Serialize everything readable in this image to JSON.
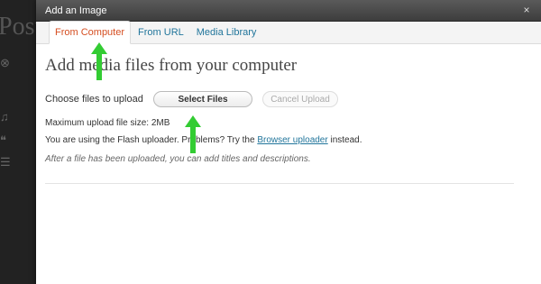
{
  "background": {
    "post_title_fragment": "Post"
  },
  "modal": {
    "title": "Add an Image",
    "close_glyph": "×"
  },
  "tabs": [
    {
      "label": "From Computer",
      "active": true
    },
    {
      "label": "From URL",
      "active": false
    },
    {
      "label": "Media Library",
      "active": false
    }
  ],
  "content": {
    "heading": "Add media files from your computer",
    "choose_label": "Choose files to upload",
    "select_button": "Select Files",
    "cancel_button": "Cancel Upload",
    "max_size": "Maximum upload file size: 2MB",
    "flash_prefix": "You are using the Flash uploader. Problems? Try the ",
    "flash_link": "Browser uploader",
    "flash_suffix": " instead.",
    "after_upload": "After a file has been uploaded, you can add titles and descriptions."
  },
  "colors": {
    "accent_tab": "#d54e21",
    "link": "#21759b",
    "arrow": "#33cc33"
  }
}
